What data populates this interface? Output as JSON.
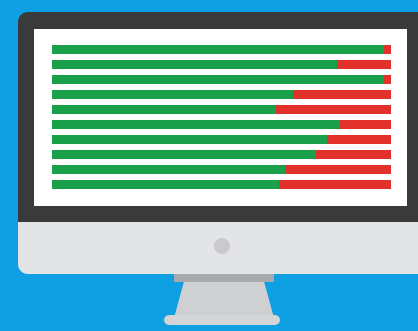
{
  "colors": {
    "background": "#0ea0e3",
    "monitor_frame": "#3a3a3a",
    "monitor_chin": "#e3e4e6",
    "power_button": "#c9cacc",
    "stand": "#cfd0d2",
    "stand_shadow": "#a9aaad",
    "base": "#d4d5d7",
    "screen": "#ffffff",
    "positive": "#1aa04a",
    "negative": "#e2302a"
  },
  "bars": [
    {
      "positive": 0.98,
      "negative": 0.02
    },
    {
      "positive": 0.84,
      "negative": 0.16
    },
    {
      "positive": 0.98,
      "negative": 0.02
    },
    {
      "positive": 0.71,
      "negative": 0.29
    },
    {
      "positive": 0.66,
      "negative": 0.34
    },
    {
      "positive": 0.85,
      "negative": 0.15
    },
    {
      "positive": 0.81,
      "negative": 0.19
    },
    {
      "positive": 0.78,
      "negative": 0.22
    },
    {
      "positive": 0.69,
      "negative": 0.31
    },
    {
      "positive": 0.67,
      "negative": 0.33
    }
  ]
}
